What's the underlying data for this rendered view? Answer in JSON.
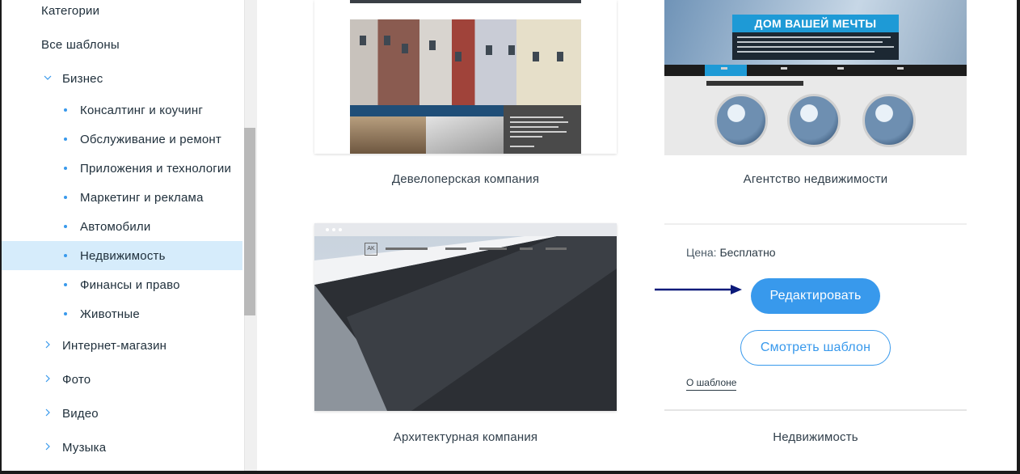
{
  "sidebar": {
    "heading": "Категории",
    "all_templates": "Все шаблоны",
    "categories": [
      {
        "label": "Бизнес",
        "expanded": true
      },
      {
        "label": "Интернет-магазин",
        "expanded": false
      },
      {
        "label": "Фото",
        "expanded": false
      },
      {
        "label": "Видео",
        "expanded": false
      },
      {
        "label": "Музыка",
        "expanded": false
      }
    ],
    "business_subcategories": [
      {
        "label": "Консалтинг и коучинг"
      },
      {
        "label": "Обслуживание и ремонт"
      },
      {
        "label": "Приложения и технологии"
      },
      {
        "label": "Маркетинг и реклама"
      },
      {
        "label": "Автомобили"
      },
      {
        "label": "Недвижимость",
        "selected": true
      },
      {
        "label": "Финансы и право"
      },
      {
        "label": "Животные"
      }
    ]
  },
  "templates": [
    {
      "caption": "Девелоперская компания"
    },
    {
      "caption": "Агентство недвижимости",
      "hero_title": "ДОМ ВАШЕЙ МЕЧТЫ"
    },
    {
      "caption": "Архитектурная компания",
      "logo_text": "AK"
    },
    {
      "caption": "Недвижимость"
    }
  ],
  "hover_panel": {
    "price_label": "Цена:",
    "price_value": "Бесплатно",
    "edit_button": "Редактировать",
    "view_button": "Смотреть шаблон",
    "about_link": "О шаблоне"
  },
  "colors": {
    "accent": "#3899ec",
    "selected_bg": "#d6ecfb",
    "arrow": "#0b1a7a"
  }
}
